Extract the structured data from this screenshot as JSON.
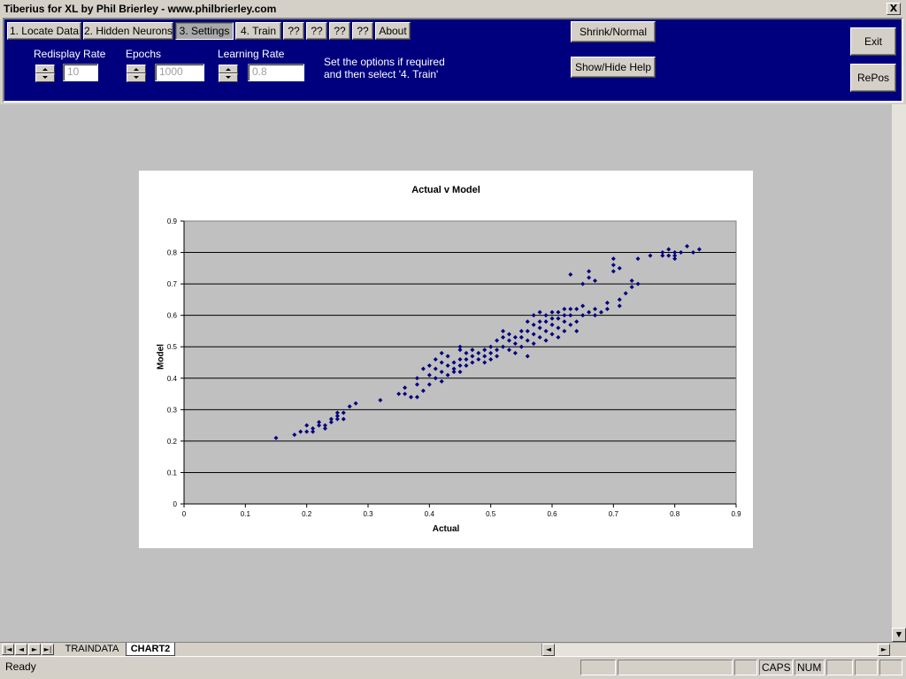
{
  "window": {
    "title": "Tiberius for XL by Phil Brierley - www.philbrierley.com",
    "close_label": "X"
  },
  "toolbar": {
    "tabs": [
      {
        "label": "1. Locate Data"
      },
      {
        "label": "2. Hidden Neurons"
      },
      {
        "label": "3. Settings"
      },
      {
        "label": "4. Train"
      },
      {
        "label": "??"
      },
      {
        "label": "??"
      },
      {
        "label": "??"
      },
      {
        "label": "??"
      },
      {
        "label": "About"
      }
    ],
    "shrink_label": "Shrink/Normal",
    "help_label": "Show/Hide Help",
    "exit_label": "Exit",
    "repos_label": "RePos"
  },
  "settings": {
    "redisplay_label": "Redisplay Rate",
    "redisplay_value": "10",
    "epochs_label": "Epochs",
    "epochs_value": "1000",
    "lr_label": "Learning Rate",
    "lr_value": "0.8",
    "help_line1": "Set the options if required",
    "help_line2": "and then select '4. Train'"
  },
  "chart_data": {
    "type": "scatter",
    "title": "Actual v Model",
    "xlabel": "Actual",
    "ylabel": "Model",
    "xlim": [
      0,
      0.9
    ],
    "ylim": [
      0,
      0.9
    ],
    "xticks": [
      "0",
      "0.1",
      "0.2",
      "0.3",
      "0.4",
      "0.5",
      "0.6",
      "0.7",
      "0.8",
      "0.9"
    ],
    "yticks": [
      "0",
      "0.1",
      "0.2",
      "0.3",
      "0.4",
      "0.5",
      "0.6",
      "0.7",
      "0.8",
      "0.9"
    ],
    "grid": "horizontal",
    "legend": "none",
    "marker_color": "#000080",
    "plot_bg": "#c0c0c0",
    "points": [
      [
        0.15,
        0.21
      ],
      [
        0.18,
        0.22
      ],
      [
        0.19,
        0.23
      ],
      [
        0.2,
        0.23
      ],
      [
        0.2,
        0.25
      ],
      [
        0.21,
        0.23
      ],
      [
        0.21,
        0.24
      ],
      [
        0.22,
        0.25
      ],
      [
        0.22,
        0.26
      ],
      [
        0.23,
        0.24
      ],
      [
        0.23,
        0.25
      ],
      [
        0.24,
        0.26
      ],
      [
        0.24,
        0.27
      ],
      [
        0.25,
        0.27
      ],
      [
        0.25,
        0.28
      ],
      [
        0.25,
        0.29
      ],
      [
        0.26,
        0.27
      ],
      [
        0.26,
        0.29
      ],
      [
        0.27,
        0.31
      ],
      [
        0.28,
        0.32
      ],
      [
        0.32,
        0.33
      ],
      [
        0.35,
        0.35
      ],
      [
        0.36,
        0.35
      ],
      [
        0.36,
        0.37
      ],
      [
        0.37,
        0.34
      ],
      [
        0.38,
        0.34
      ],
      [
        0.38,
        0.38
      ],
      [
        0.38,
        0.4
      ],
      [
        0.39,
        0.36
      ],
      [
        0.39,
        0.43
      ],
      [
        0.4,
        0.38
      ],
      [
        0.4,
        0.41
      ],
      [
        0.4,
        0.44
      ],
      [
        0.41,
        0.4
      ],
      [
        0.41,
        0.43
      ],
      [
        0.41,
        0.46
      ],
      [
        0.42,
        0.39
      ],
      [
        0.42,
        0.42
      ],
      [
        0.42,
        0.45
      ],
      [
        0.42,
        0.48
      ],
      [
        0.43,
        0.41
      ],
      [
        0.43,
        0.44
      ],
      [
        0.43,
        0.47
      ],
      [
        0.44,
        0.42
      ],
      [
        0.44,
        0.43
      ],
      [
        0.44,
        0.45
      ],
      [
        0.45,
        0.42
      ],
      [
        0.45,
        0.44
      ],
      [
        0.45,
        0.46
      ],
      [
        0.45,
        0.49
      ],
      [
        0.45,
        0.5
      ],
      [
        0.46,
        0.44
      ],
      [
        0.46,
        0.46
      ],
      [
        0.46,
        0.48
      ],
      [
        0.47,
        0.45
      ],
      [
        0.47,
        0.47
      ],
      [
        0.47,
        0.49
      ],
      [
        0.48,
        0.46
      ],
      [
        0.48,
        0.48
      ],
      [
        0.49,
        0.45
      ],
      [
        0.49,
        0.47
      ],
      [
        0.49,
        0.49
      ],
      [
        0.5,
        0.46
      ],
      [
        0.5,
        0.48
      ],
      [
        0.5,
        0.5
      ],
      [
        0.51,
        0.47
      ],
      [
        0.51,
        0.49
      ],
      [
        0.51,
        0.52
      ],
      [
        0.52,
        0.5
      ],
      [
        0.52,
        0.53
      ],
      [
        0.52,
        0.55
      ],
      [
        0.53,
        0.49
      ],
      [
        0.53,
        0.52
      ],
      [
        0.53,
        0.54
      ],
      [
        0.54,
        0.48
      ],
      [
        0.54,
        0.51
      ],
      [
        0.54,
        0.53
      ],
      [
        0.55,
        0.5
      ],
      [
        0.55,
        0.53
      ],
      [
        0.55,
        0.55
      ],
      [
        0.56,
        0.47
      ],
      [
        0.56,
        0.52
      ],
      [
        0.56,
        0.55
      ],
      [
        0.56,
        0.58
      ],
      [
        0.57,
        0.51
      ],
      [
        0.57,
        0.54
      ],
      [
        0.57,
        0.57
      ],
      [
        0.57,
        0.6
      ],
      [
        0.58,
        0.53
      ],
      [
        0.58,
        0.56
      ],
      [
        0.58,
        0.58
      ],
      [
        0.58,
        0.61
      ],
      [
        0.59,
        0.52
      ],
      [
        0.59,
        0.55
      ],
      [
        0.59,
        0.58
      ],
      [
        0.59,
        0.6
      ],
      [
        0.6,
        0.54
      ],
      [
        0.6,
        0.57
      ],
      [
        0.6,
        0.59
      ],
      [
        0.6,
        0.61
      ],
      [
        0.61,
        0.53
      ],
      [
        0.61,
        0.56
      ],
      [
        0.61,
        0.59
      ],
      [
        0.61,
        0.61
      ],
      [
        0.62,
        0.55
      ],
      [
        0.62,
        0.58
      ],
      [
        0.62,
        0.6
      ],
      [
        0.62,
        0.62
      ],
      [
        0.63,
        0.57
      ],
      [
        0.63,
        0.6
      ],
      [
        0.63,
        0.62
      ],
      [
        0.63,
        0.73
      ],
      [
        0.64,
        0.55
      ],
      [
        0.64,
        0.58
      ],
      [
        0.64,
        0.62
      ],
      [
        0.65,
        0.6
      ],
      [
        0.65,
        0.63
      ],
      [
        0.65,
        0.7
      ],
      [
        0.66,
        0.61
      ],
      [
        0.66,
        0.72
      ],
      [
        0.66,
        0.74
      ],
      [
        0.67,
        0.6
      ],
      [
        0.67,
        0.62
      ],
      [
        0.67,
        0.71
      ],
      [
        0.68,
        0.61
      ],
      [
        0.69,
        0.62
      ],
      [
        0.69,
        0.64
      ],
      [
        0.7,
        0.74
      ],
      [
        0.7,
        0.76
      ],
      [
        0.7,
        0.78
      ],
      [
        0.71,
        0.63
      ],
      [
        0.71,
        0.65
      ],
      [
        0.71,
        0.75
      ],
      [
        0.72,
        0.67
      ],
      [
        0.73,
        0.69
      ],
      [
        0.73,
        0.71
      ],
      [
        0.74,
        0.7
      ],
      [
        0.74,
        0.78
      ],
      [
        0.76,
        0.79
      ],
      [
        0.78,
        0.79
      ],
      [
        0.78,
        0.8
      ],
      [
        0.79,
        0.79
      ],
      [
        0.79,
        0.81
      ],
      [
        0.8,
        0.8
      ],
      [
        0.8,
        0.78
      ],
      [
        0.81,
        0.8
      ],
      [
        0.82,
        0.82
      ],
      [
        0.83,
        0.8
      ],
      [
        0.84,
        0.81
      ],
      [
        0.8,
        0.79
      ]
    ]
  },
  "sheets": {
    "tab1": "TRAINDATA",
    "tab2": "CHART2",
    "nav_first": "|◄",
    "nav_prev": "◄",
    "nav_next": "►",
    "nav_last": "►|"
  },
  "status": {
    "ready": "Ready",
    "caps": "CAPS",
    "num": "NUM"
  }
}
